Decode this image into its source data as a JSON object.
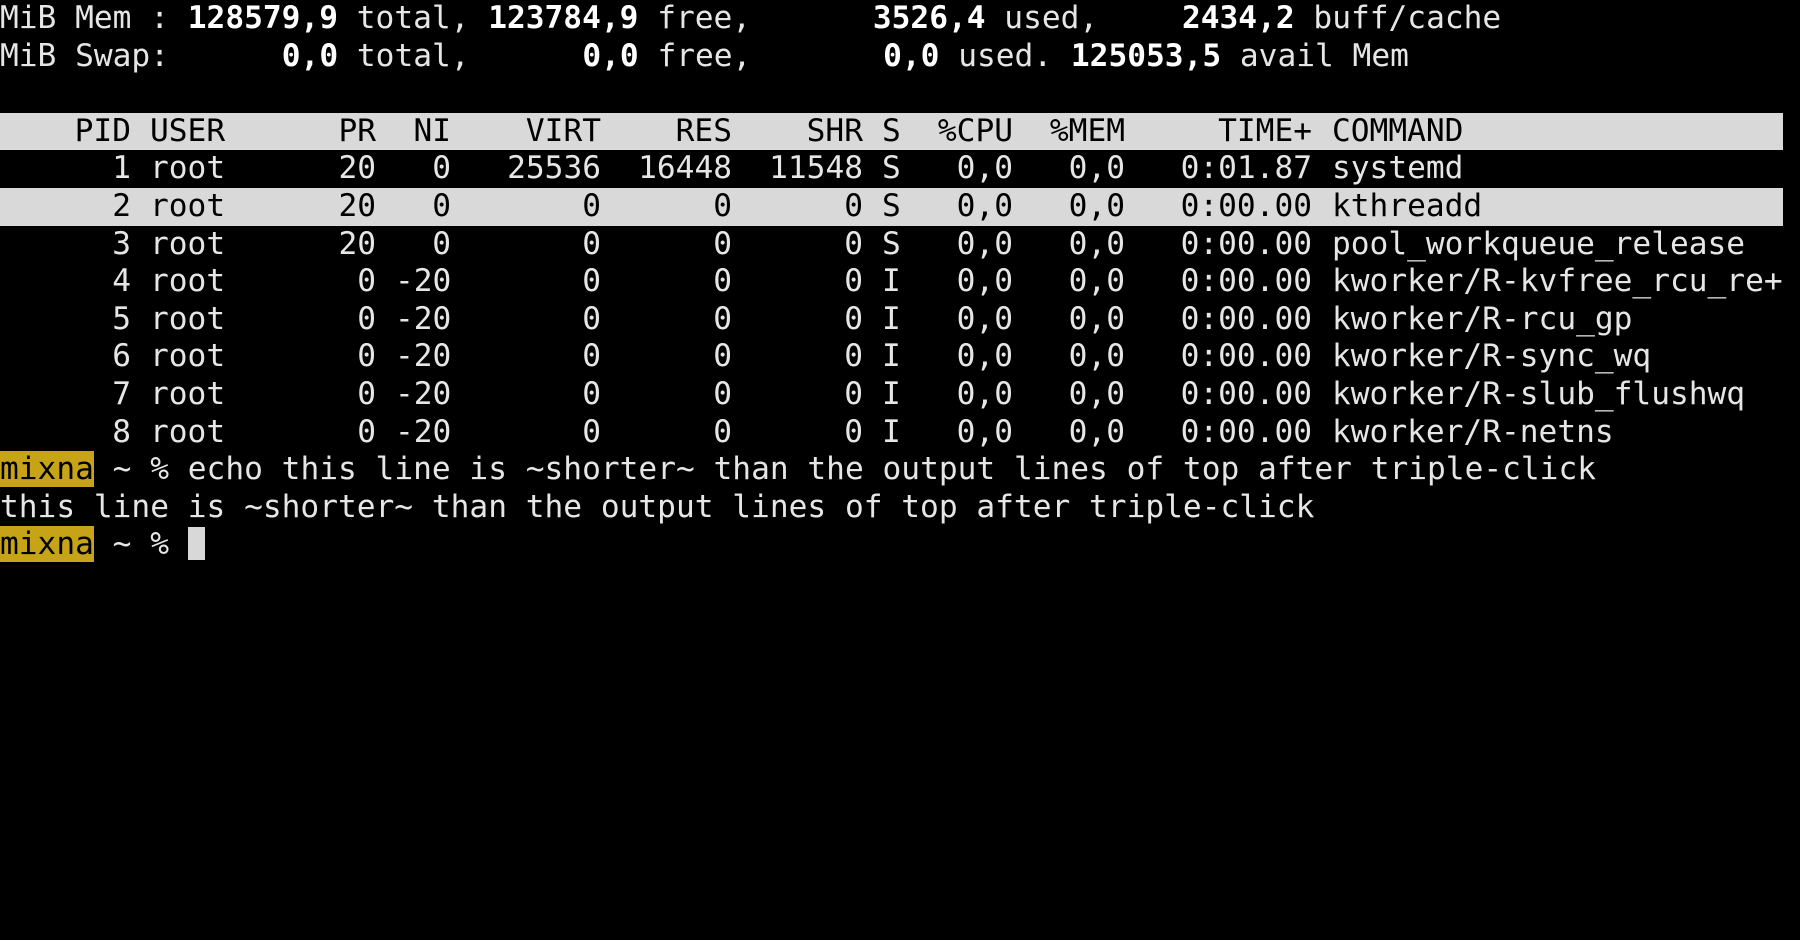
{
  "summary": {
    "mem": {
      "prefix": "MiB Mem : ",
      "total": "128579,9",
      "total_label": " total, ",
      "free": "123784,9",
      "free_label": " free, ",
      "used": "3526,4",
      "used_label": " used, ",
      "buff": "2434,2",
      "buff_label": " buff/cache"
    },
    "swap": {
      "prefix": "MiB Swap: ",
      "total": "0,0",
      "total_label": " total, ",
      "free": "0,0",
      "free_label": " free, ",
      "used": "0,0",
      "used_label": " used. ",
      "avail": "125053,5",
      "avail_label": " avail Mem"
    }
  },
  "table": {
    "headers": [
      "PID",
      "USER",
      "PR",
      "NI",
      "VIRT",
      "RES",
      "SHR",
      "S",
      "%CPU",
      "%MEM",
      "TIME+",
      "COMMAND"
    ],
    "rows": [
      [
        "1",
        "root",
        "20",
        "0",
        "25536",
        "16448",
        "11548",
        "S",
        "0,0",
        "0,0",
        "0:01.87",
        "systemd"
      ],
      [
        "2",
        "root",
        "20",
        "0",
        "0",
        "0",
        "0",
        "S",
        "0,0",
        "0,0",
        "0:00.00",
        "kthreadd"
      ],
      [
        "3",
        "root",
        "20",
        "0",
        "0",
        "0",
        "0",
        "S",
        "0,0",
        "0,0",
        "0:00.00",
        "pool_workqueue_release"
      ],
      [
        "4",
        "root",
        "0",
        "-20",
        "0",
        "0",
        "0",
        "I",
        "0,0",
        "0,0",
        "0:00.00",
        "kworker/R-kvfree_rcu_re+"
      ],
      [
        "5",
        "root",
        "0",
        "-20",
        "0",
        "0",
        "0",
        "I",
        "0,0",
        "0,0",
        "0:00.00",
        "kworker/R-rcu_gp"
      ],
      [
        "6",
        "root",
        "0",
        "-20",
        "0",
        "0",
        "0",
        "I",
        "0,0",
        "0,0",
        "0:00.00",
        "kworker/R-sync_wq"
      ],
      [
        "7",
        "root",
        "0",
        "-20",
        "0",
        "0",
        "0",
        "I",
        "0,0",
        "0,0",
        "0:00.00",
        "kworker/R-slub_flushwq"
      ],
      [
        "8",
        "root",
        "0",
        "-20",
        "0",
        "0",
        "0",
        "I",
        "0,0",
        "0,0",
        "0:00.00",
        "kworker/R-netns"
      ]
    ]
  },
  "shell": {
    "prompt_user": "mixna",
    "prompt_rest": " ~ % ",
    "command": "echo this line is ~shorter~ than the output lines of top after triple-click",
    "output": "this line is ~shorter~ than the output lines of top after triple-click"
  },
  "colors": {
    "background": "#000000",
    "text": "#e6e6e6",
    "header_bg": "#d9d9d9",
    "prompt_bg": "#c7a417"
  }
}
